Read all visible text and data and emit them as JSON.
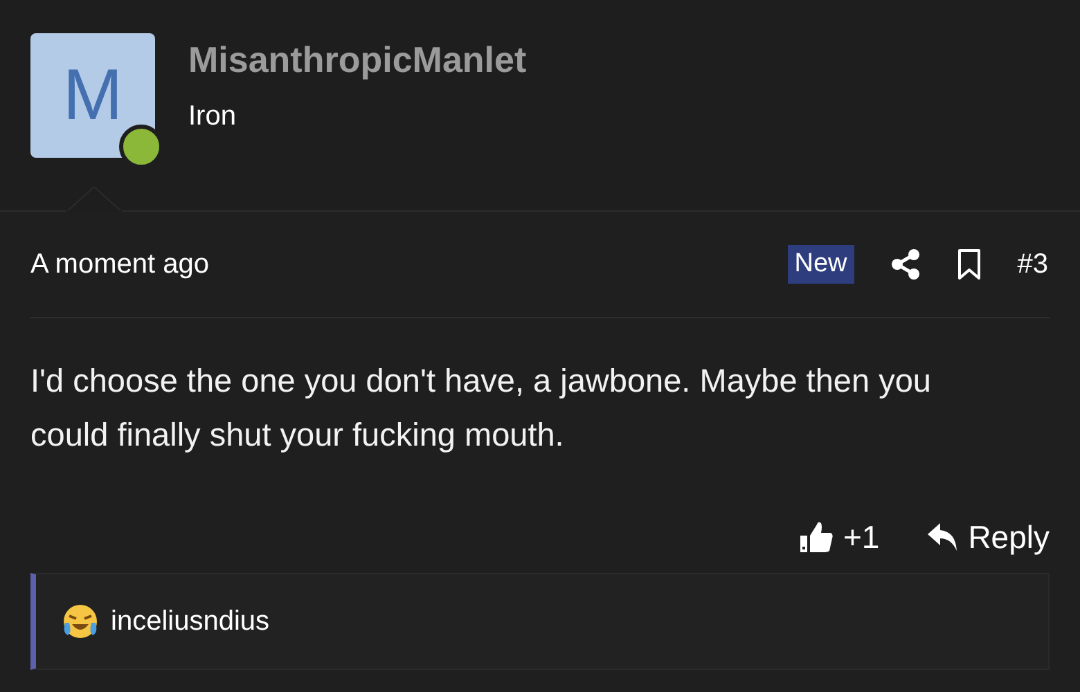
{
  "author": {
    "avatar_letter": "M",
    "online": true,
    "username": "MisanthropicManlet",
    "rank": "Iron"
  },
  "post": {
    "time": "A moment ago",
    "badge": "New",
    "number": "#3",
    "text": "I'd choose the one you don't have, a jawbone. Maybe then you could finally shut your fucking mouth.",
    "likes": "+1",
    "reply": "Reply"
  },
  "quote": {
    "author": "inceliusndius"
  }
}
